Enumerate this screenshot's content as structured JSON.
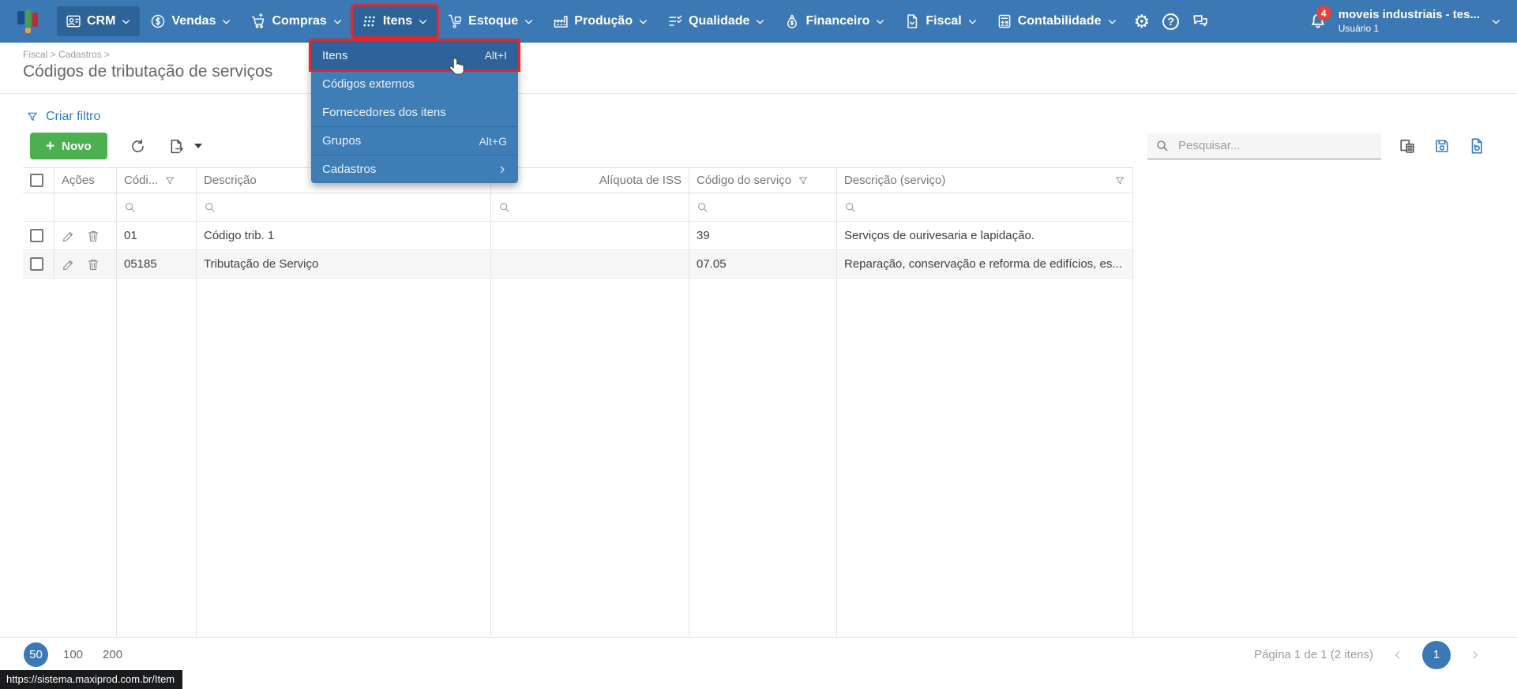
{
  "topbar": {
    "menus": [
      {
        "label": "CRM"
      },
      {
        "label": "Vendas"
      },
      {
        "label": "Compras"
      },
      {
        "label": "Itens"
      },
      {
        "label": "Estoque"
      },
      {
        "label": "Produção"
      },
      {
        "label": "Qualidade"
      },
      {
        "label": "Financeiro"
      },
      {
        "label": "Fiscal"
      },
      {
        "label": "Contabilidade"
      }
    ],
    "help_glyph": "?",
    "gear_glyph": "⚙",
    "notifications_count": "4",
    "account_name": "moveis industriais - tes...",
    "account_user": "Usuário 1"
  },
  "dropdown": {
    "items": [
      {
        "label": "Itens",
        "shortcut": "Alt+I"
      },
      {
        "label": "Códigos externos",
        "shortcut": ""
      },
      {
        "label": "Fornecedores dos itens",
        "shortcut": ""
      },
      {
        "label": "Grupos",
        "shortcut": "Alt+G"
      },
      {
        "label": "Cadastros",
        "shortcut": ""
      }
    ]
  },
  "page": {
    "breadcrumb": "Fiscal > Cadastros >",
    "title": "Códigos de tributação de serviços"
  },
  "toolbar": {
    "create_filter_label": "Criar filtro",
    "new_button_label": "Novo",
    "new_button_plus": "+",
    "search_placeholder": "Pesquisar..."
  },
  "grid": {
    "columns": [
      {
        "label": ""
      },
      {
        "label": "Ações"
      },
      {
        "label": "Códi..."
      },
      {
        "label": "Descrição"
      },
      {
        "label": "Alíquota de ISS"
      },
      {
        "label": "Código do serviço"
      },
      {
        "label": "Descrição (serviço)"
      }
    ],
    "rows": [
      {
        "codigo": "01",
        "descricao": "Código trib. 1",
        "aliquota_iss": "",
        "codigo_servico": "39",
        "descricao_servico": "Serviços de ourivesaria e lapidação."
      },
      {
        "codigo": "05185",
        "descricao": "Tributação de Serviço",
        "aliquota_iss": "",
        "codigo_servico": "07.05",
        "descricao_servico": "Reparação, conservação e reforma de edifícios, es..."
      }
    ]
  },
  "pager": {
    "sizes": [
      "50",
      "100",
      "200"
    ],
    "active_size": "50",
    "info": "Página 1 de 1 (2 itens)",
    "current_page": "1"
  },
  "status_url": "https://sistema.maxiprod.com.br/Item",
  "colors": {
    "topbar_blue": "#3c79b4",
    "selected_blue": "#2d6398",
    "annotation_red": "#e8252a",
    "accent_blue": "#3a79b5",
    "button_green": "#4caf50"
  }
}
